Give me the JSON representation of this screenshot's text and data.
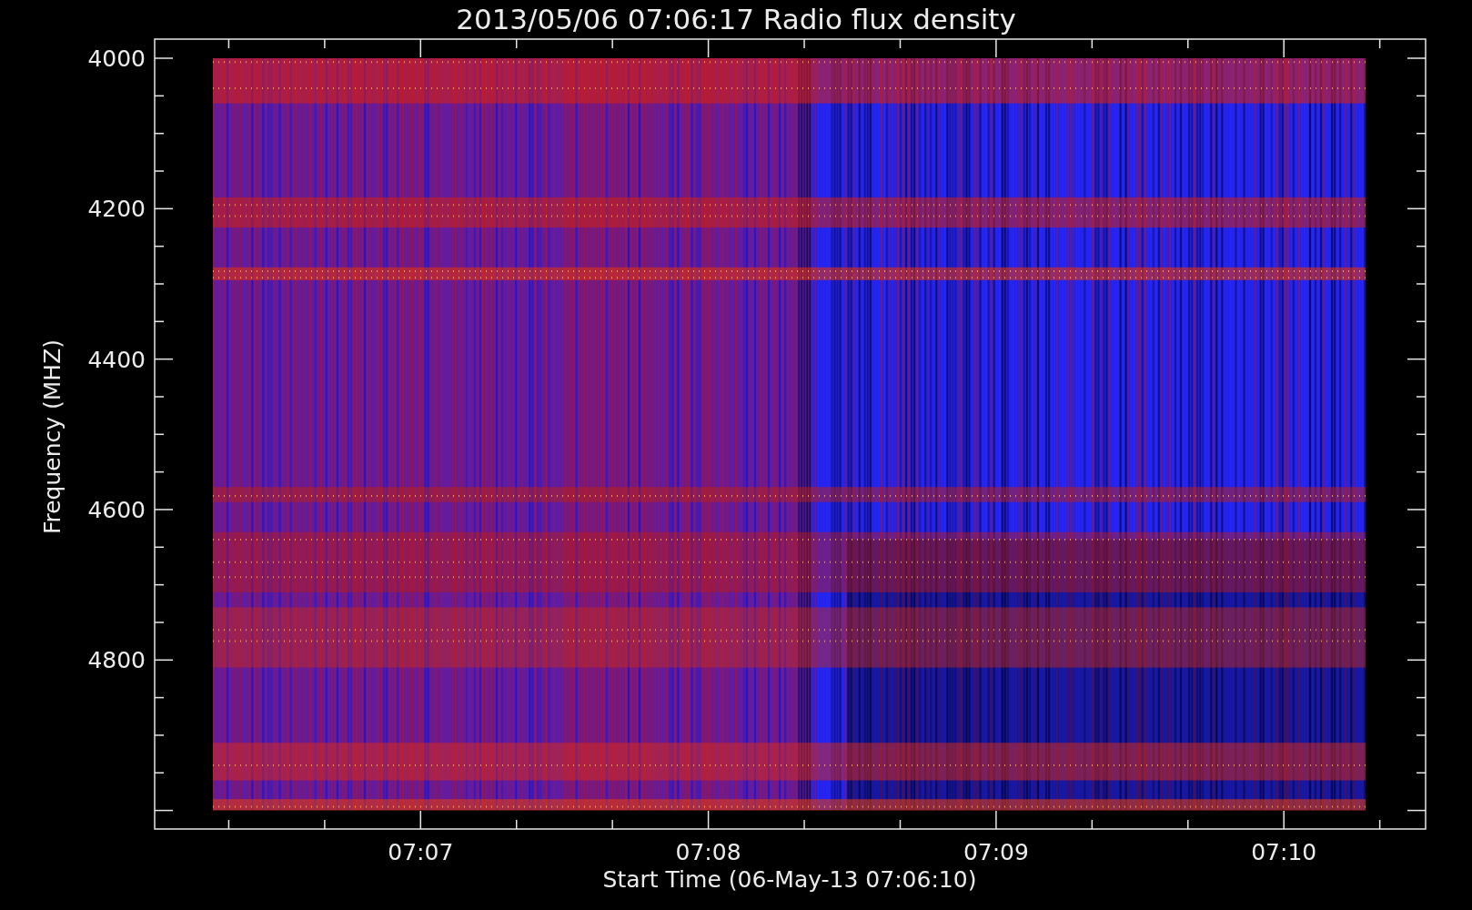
{
  "title": "2013/05/06 07:06:17 Radio flux density",
  "y_axis": {
    "label": "Frequency (MHZ)",
    "ticks": [
      "4000",
      "4200",
      "4400",
      "4600",
      "4800"
    ]
  },
  "x_axis": {
    "label": "Start Time (06-May-13 07:06:10)",
    "ticks": [
      "07:07",
      "07:08",
      "07:09",
      "07:10"
    ]
  }
}
